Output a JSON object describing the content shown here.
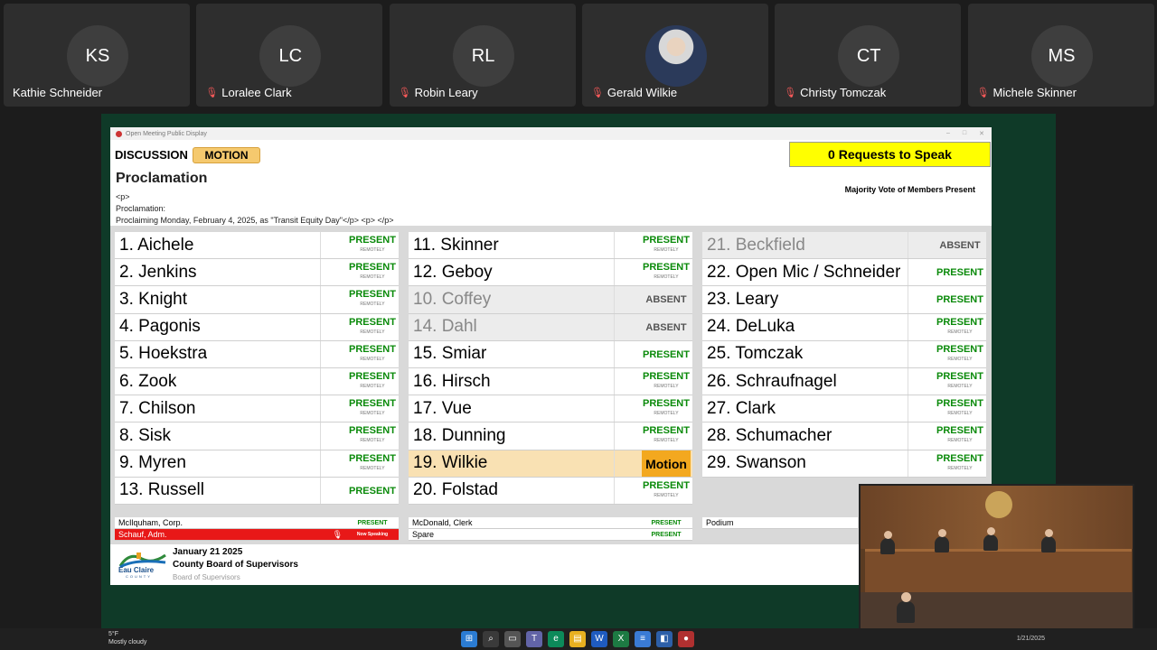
{
  "participants": [
    {
      "initials": "KS",
      "name": "Kathie Schneider",
      "muted": false,
      "photo": false
    },
    {
      "initials": "LC",
      "name": "Loralee Clark",
      "muted": true,
      "photo": false
    },
    {
      "initials": "RL",
      "name": "Robin Leary",
      "muted": true,
      "photo": false
    },
    {
      "initials": "",
      "name": "Gerald Wilkie",
      "muted": true,
      "photo": true
    },
    {
      "initials": "CT",
      "name": "Christy Tomczak",
      "muted": true,
      "photo": false
    },
    {
      "initials": "MS",
      "name": "Michele Skinner",
      "muted": true,
      "photo": false
    }
  ],
  "window": {
    "title": "Open Meeting Public Display",
    "tab_discussion": "DISCUSSION",
    "tab_motion": "MOTION",
    "requests": "0 Requests to Speak",
    "majority": "Majority Vote of Members Present",
    "item_title": "Proclamation",
    "item_text": "<p>\nProclamation:\nProclaiming Monday, February 4, 2025, as \"Transit Equity Day\"</p> <p> </p>"
  },
  "columns": [
    [
      {
        "name": "1. Aichele",
        "status": "PRESENT",
        "remote": "REMOTELY",
        "state": "present"
      },
      {
        "name": "2. Jenkins",
        "status": "PRESENT",
        "remote": "REMOTELY",
        "state": "present"
      },
      {
        "name": "3. Knight",
        "status": "PRESENT",
        "remote": "REMOTELY",
        "state": "present"
      },
      {
        "name": "4. Pagonis",
        "status": "PRESENT",
        "remote": "REMOTELY",
        "state": "present"
      },
      {
        "name": "5. Hoekstra",
        "status": "PRESENT",
        "remote": "REMOTELY",
        "state": "present"
      },
      {
        "name": "6. Zook",
        "status": "PRESENT",
        "remote": "REMOTELY",
        "state": "present"
      },
      {
        "name": "7. Chilson",
        "status": "PRESENT",
        "remote": "REMOTELY",
        "state": "present"
      },
      {
        "name": "8. Sisk",
        "status": "PRESENT",
        "remote": "REMOTELY",
        "state": "present"
      },
      {
        "name": "9. Myren",
        "status": "PRESENT",
        "remote": "REMOTELY",
        "state": "present"
      },
      {
        "name": "13. Russell",
        "status": "PRESENT",
        "remote": "",
        "state": "present"
      }
    ],
    [
      {
        "name": "11. Skinner",
        "status": "PRESENT",
        "remote": "REMOTELY",
        "state": "present"
      },
      {
        "name": "12. Geboy",
        "status": "PRESENT",
        "remote": "REMOTELY",
        "state": "present"
      },
      {
        "name": "10. Coffey",
        "status": "ABSENT",
        "remote": "",
        "state": "absent"
      },
      {
        "name": "14. Dahl",
        "status": "ABSENT",
        "remote": "",
        "state": "absent"
      },
      {
        "name": "15. Smiar",
        "status": "PRESENT",
        "remote": "",
        "state": "present"
      },
      {
        "name": "16. Hirsch",
        "status": "PRESENT",
        "remote": "REMOTELY",
        "state": "present"
      },
      {
        "name": "17. Vue",
        "status": "PRESENT",
        "remote": "REMOTELY",
        "state": "present"
      },
      {
        "name": "18. Dunning",
        "status": "PRESENT",
        "remote": "REMOTELY",
        "state": "present"
      },
      {
        "name": "19. Wilkie",
        "status": "Motion",
        "remote": "",
        "state": "motion"
      },
      {
        "name": "20. Folstad",
        "status": "PRESENT",
        "remote": "REMOTELY",
        "state": "present"
      }
    ],
    [
      {
        "name": "21. Beckfield",
        "status": "ABSENT",
        "remote": "",
        "state": "absent"
      },
      {
        "name": "22. Open Mic / Schneider",
        "status": "PRESENT",
        "remote": "",
        "state": "present"
      },
      {
        "name": "23. Leary",
        "status": "PRESENT",
        "remote": "",
        "state": "present"
      },
      {
        "name": "24. DeLuka",
        "status": "PRESENT",
        "remote": "REMOTELY",
        "state": "present"
      },
      {
        "name": "25. Tomczak",
        "status": "PRESENT",
        "remote": "REMOTELY",
        "state": "present"
      },
      {
        "name": "26. Schraufnagel",
        "status": "PRESENT",
        "remote": "REMOTELY",
        "state": "present"
      },
      {
        "name": "27. Clark",
        "status": "PRESENT",
        "remote": "REMOTELY",
        "state": "present"
      },
      {
        "name": "28. Schumacher",
        "status": "PRESENT",
        "remote": "REMOTELY",
        "state": "present"
      },
      {
        "name": "29. Swanson",
        "status": "PRESENT",
        "remote": "REMOTELY",
        "state": "present"
      }
    ]
  ],
  "staff": {
    "mcilquham": "McIlquham, Corp.",
    "mcilquham_status": "PRESENT",
    "schauf": "Schauf, Adm.",
    "schauf_status": "Now Speaking",
    "mcdonald": "McDonald, Clerk",
    "mcdonald_status": "PRESENT",
    "spare": "Spare",
    "spare_status": "PRESENT",
    "podium": "Podium"
  },
  "footer": {
    "logo_text": "Eau Claire",
    "logo_sub": "COUNTY",
    "date": "January 21 2025",
    "board": "County Board of Supervisors",
    "sub": "Board of Supervisors"
  },
  "taskbar": {
    "temp": "5°F",
    "weather": "Mostly cloudy",
    "date": "1/21/2025"
  },
  "colors": {
    "present": "#0a8a0a",
    "motion_bg": "#f3a81f",
    "requests_bg": "#ffff00",
    "speaking_bg": "#e81818"
  }
}
